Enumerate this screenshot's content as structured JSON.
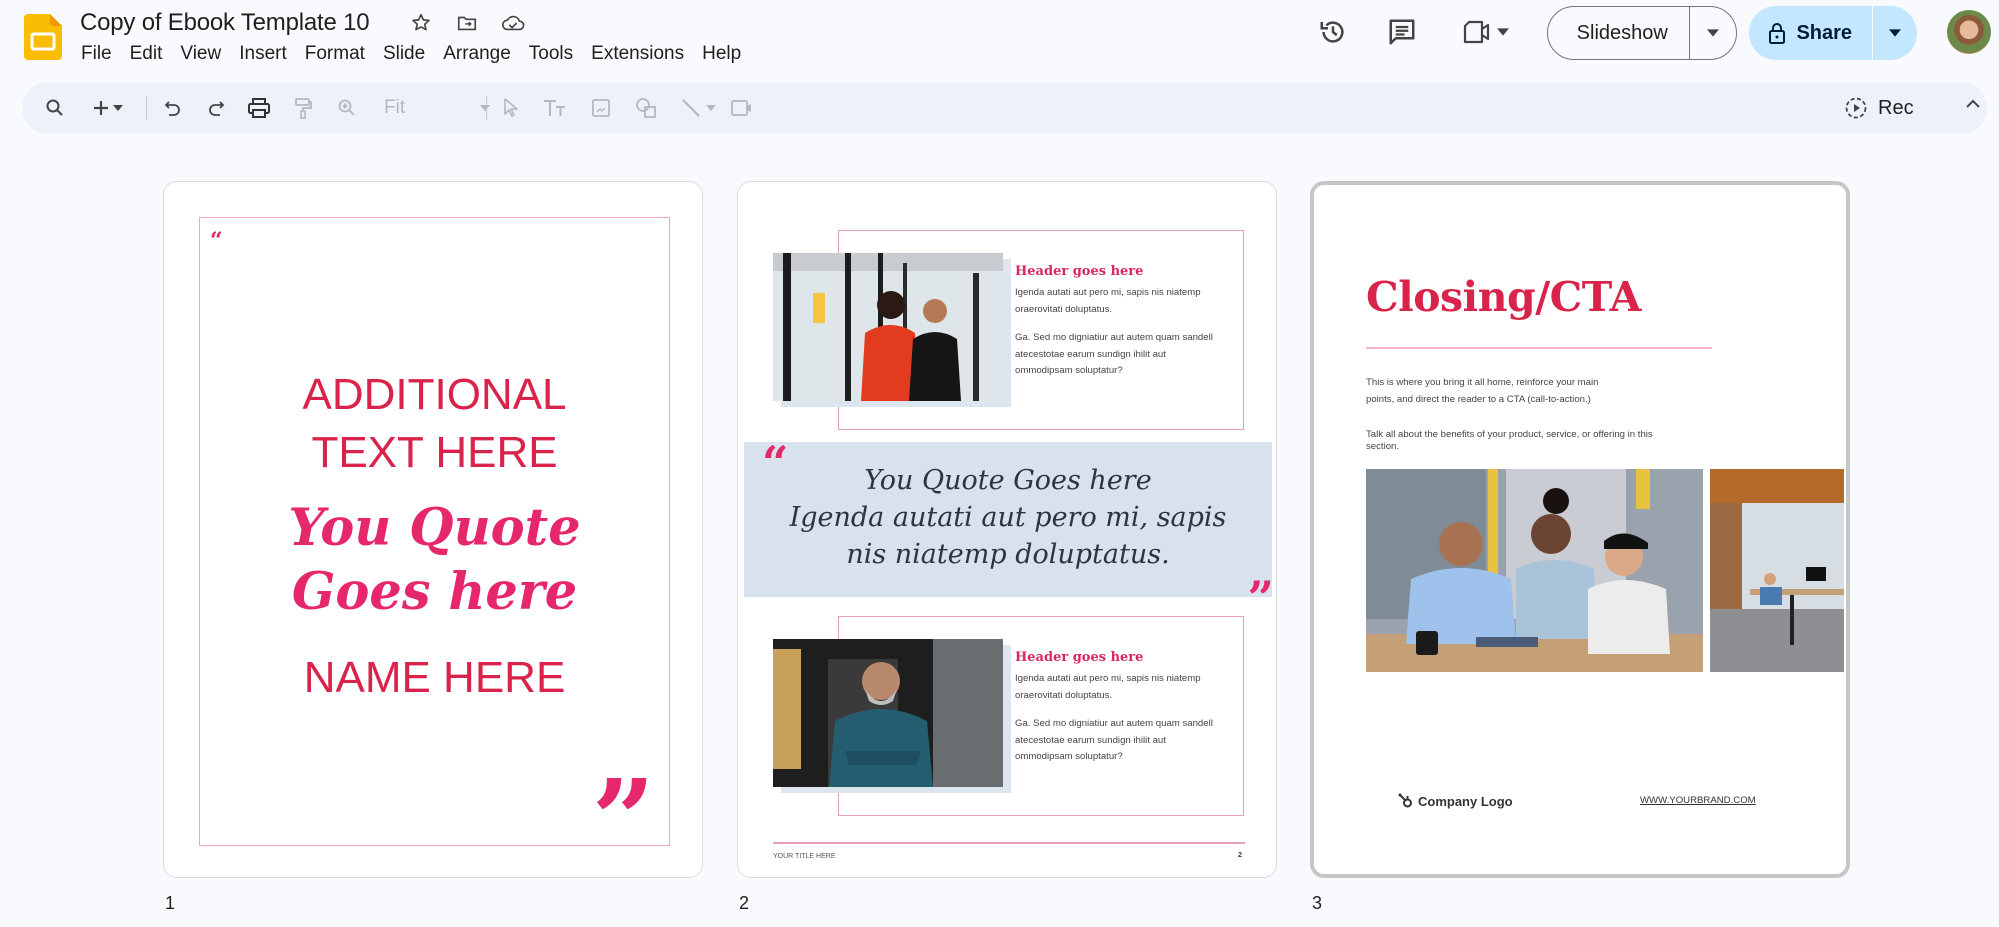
{
  "header": {
    "title": "Copy of Ebook Template 10",
    "title_icons": [
      "star-icon",
      "move-to-folder-icon",
      "cloud-saved-icon"
    ],
    "menu": [
      "File",
      "Edit",
      "View",
      "Insert",
      "Format",
      "Slide",
      "Arrange",
      "Tools",
      "Extensions",
      "Help"
    ],
    "right_icons": [
      "version-history-icon",
      "comments-icon",
      "meet-icon"
    ],
    "slideshow_label": "Slideshow",
    "share_label": "Share",
    "share_color": "#c2e7ff"
  },
  "toolbar": {
    "zoom_value": "Fit",
    "rec_label": "Rec"
  },
  "slides": [
    {
      "number": "1",
      "open_quote": "“",
      "additional_text": "ADDITIONAL TEXT HERE",
      "quote": "You Quote Goes here",
      "name": "NAME HERE",
      "close_quote": "”"
    },
    {
      "number": "2",
      "sections": [
        {
          "header": "Header goes here",
          "para1": "Igenda autati aut pero mi, sapis nis niatemp oraerovitati doluptatus.",
          "para2": "Ga. Sed mo digniatiur aut autem quam sandell atecestotae earum sundign ihilit aut ommodipsam soluptatur?"
        },
        {
          "header": "Header goes here",
          "para1": "Igenda autati aut pero mi, sapis nis niatemp oraerovitati doluptatus.",
          "para2": "Ga. Sed mo digniatiur aut autem quam sandell atecestotae earum sundign ihilit aut ommodipsam soluptatur?"
        }
      ],
      "quote_line1": "You Quote Goes here",
      "quote_line2": "Igenda autati aut pero mi, sapis nis niatemp doluptatus.",
      "open_quote": "“",
      "close_quote": "”",
      "footer_title": "YOUR TITLE HERE",
      "page_number": "2"
    },
    {
      "number": "3",
      "title": "Closing/CTA",
      "para1": "This is where you bring it all home, reinforce your main points, and direct the reader to a CTA (call-to-action.)",
      "para2": "Talk all about the benefits of your product, service, or offering in this section.",
      "logo_text": "Company Logo",
      "url": "WWW.YOURBRAND.COM",
      "selected": true
    }
  ],
  "colors": {
    "accent_red": "#d9234a",
    "accent_pink": "#e6276b",
    "quote_band": "#d7e2ec"
  }
}
